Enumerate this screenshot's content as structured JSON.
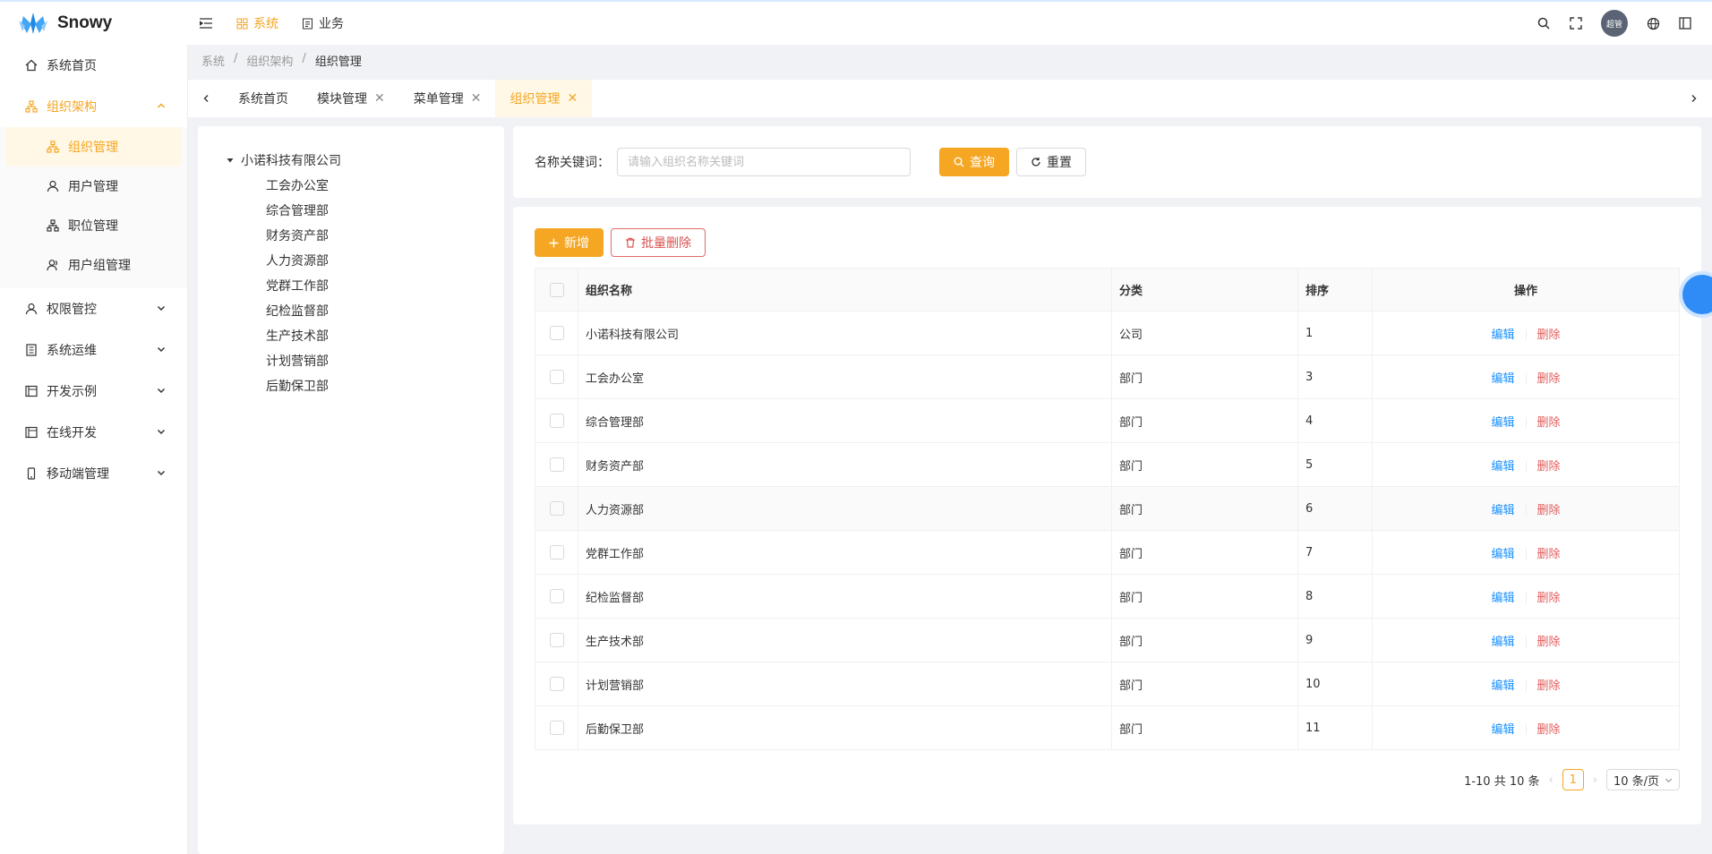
{
  "app": {
    "name": "Snowy"
  },
  "topnav": [
    {
      "label": "系统",
      "active": true
    },
    {
      "label": "业务",
      "active": false
    }
  ],
  "user": {
    "avatar_text": "超管"
  },
  "sidebar": {
    "items": [
      {
        "label": "系统首页",
        "icon": "home-icon"
      },
      {
        "label": "组织架构",
        "icon": "org-icon",
        "open": true,
        "children": [
          {
            "label": "组织管理",
            "icon": "org-icon",
            "selected": true
          },
          {
            "label": "用户管理",
            "icon": "user-icon"
          },
          {
            "label": "职位管理",
            "icon": "position-icon"
          },
          {
            "label": "用户组管理",
            "icon": "group-icon"
          }
        ]
      },
      {
        "label": "权限管控",
        "icon": "user-icon"
      },
      {
        "label": "系统运维",
        "icon": "server-icon"
      },
      {
        "label": "开发示例",
        "icon": "code-icon"
      },
      {
        "label": "在线开发",
        "icon": "code-icon"
      },
      {
        "label": "移动端管理",
        "icon": "mobile-icon"
      }
    ]
  },
  "breadcrumb": [
    "系统",
    "组织架构",
    "组织管理"
  ],
  "tabs": [
    {
      "label": "系统首页",
      "closable": false
    },
    {
      "label": "模块管理",
      "closable": true
    },
    {
      "label": "菜单管理",
      "closable": true
    },
    {
      "label": "组织管理",
      "closable": true,
      "active": true
    }
  ],
  "tree": {
    "root": "小诺科技有限公司",
    "children": [
      "工会办公室",
      "综合管理部",
      "财务资产部",
      "人力资源部",
      "党群工作部",
      "纪检监督部",
      "生产技术部",
      "计划营销部",
      "后勤保卫部"
    ]
  },
  "search": {
    "label": "名称关键词：",
    "placeholder": "请输入组织名称关键词",
    "query_label": "查询",
    "reset_label": "重置"
  },
  "toolbar": {
    "add_label": "新增",
    "batch_delete_label": "批量删除"
  },
  "table": {
    "headers": [
      "组织名称",
      "分类",
      "排序",
      "操作"
    ],
    "edit_label": "编辑",
    "delete_label": "删除",
    "rows": [
      {
        "name": "小诺科技有限公司",
        "category": "公司",
        "sort": "1"
      },
      {
        "name": "工会办公室",
        "category": "部门",
        "sort": "3"
      },
      {
        "name": "综合管理部",
        "category": "部门",
        "sort": "4"
      },
      {
        "name": "财务资产部",
        "category": "部门",
        "sort": "5"
      },
      {
        "name": "人力资源部",
        "category": "部门",
        "sort": "6"
      },
      {
        "name": "党群工作部",
        "category": "部门",
        "sort": "7"
      },
      {
        "name": "纪检监督部",
        "category": "部门",
        "sort": "8"
      },
      {
        "name": "生产技术部",
        "category": "部门",
        "sort": "9"
      },
      {
        "name": "计划营销部",
        "category": "部门",
        "sort": "10"
      },
      {
        "name": "后勤保卫部",
        "category": "部门",
        "sort": "11"
      }
    ]
  },
  "pagination": {
    "summary": "1-10 共 10 条",
    "current_page": "1",
    "page_size": "10 条/页"
  },
  "colors": {
    "primary": "#f5a623",
    "link": "#1890ff",
    "danger": "#e25b5b"
  }
}
